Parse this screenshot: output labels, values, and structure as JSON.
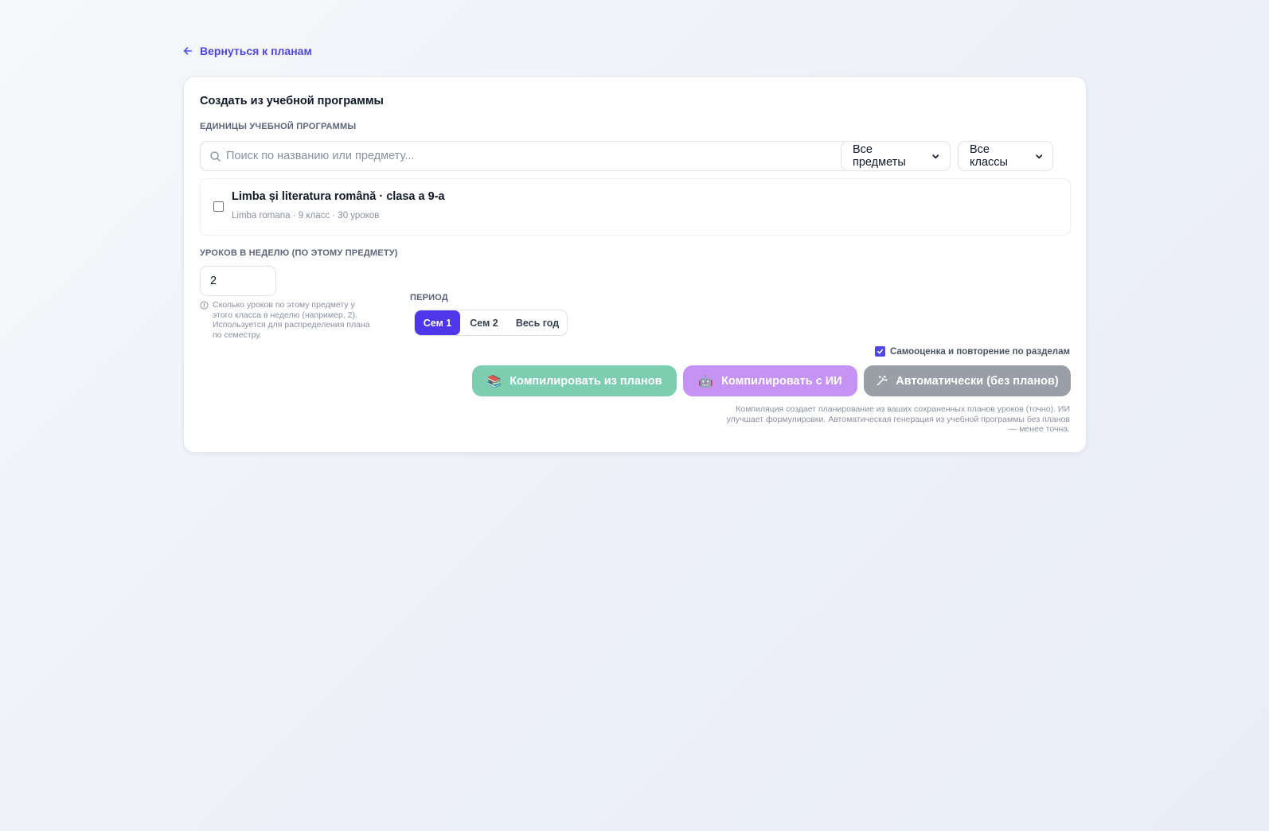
{
  "back_link": {
    "label": "Вернуться к планам"
  },
  "card": {
    "title": "Создать из учебной программы",
    "units_label": "ЕДИНИЦЫ УЧЕБНОЙ ПРОГРАММЫ",
    "search": {
      "placeholder": "Поиск по названию или предмету...",
      "value": ""
    },
    "filters": {
      "subject": "Все предметы",
      "grade": "Все классы"
    },
    "units": [
      {
        "title": "Limba și literatura română · clasa a 9-a",
        "meta": "Limba romana · 9 класс · 30 уроков",
        "checked": false
      }
    ],
    "lessons_per_week": {
      "label": "УРОКОВ В НЕДЕЛЮ (ПО ЭТОМУ ПРЕДМЕТУ)",
      "value": "2",
      "hint": "Сколько уроков по этому предмету у этого класса в неделю (например, 2). Используется для распределения плана по семестру."
    },
    "period": {
      "label": "ПЕРИОД",
      "options": [
        "Сем 1",
        "Сем 2",
        "Весь год"
      ],
      "selected": "Сем 1"
    },
    "self_assessment": {
      "label": "Самооценка и повторение по разделам",
      "checked": true
    },
    "buttons": {
      "compile_plans": {
        "emoji": "📚",
        "label": "Компилировать из планов"
      },
      "compile_ai": {
        "emoji": "🤖",
        "label": "Компилировать с ИИ"
      },
      "auto": {
        "label": "Автоматически (без планов)"
      }
    },
    "footnote": "Компиляция создает планирование из ваших сохраненных планов уроков (точно). ИИ улучшает формулировки. Автоматическая генерация из учебной программы без планов — менее точна."
  },
  "colors": {
    "accent": "#4f46e5",
    "green_button": "#7dcdb0",
    "purple_button": "#c493f3",
    "gray_button": "#9a9ea6"
  }
}
